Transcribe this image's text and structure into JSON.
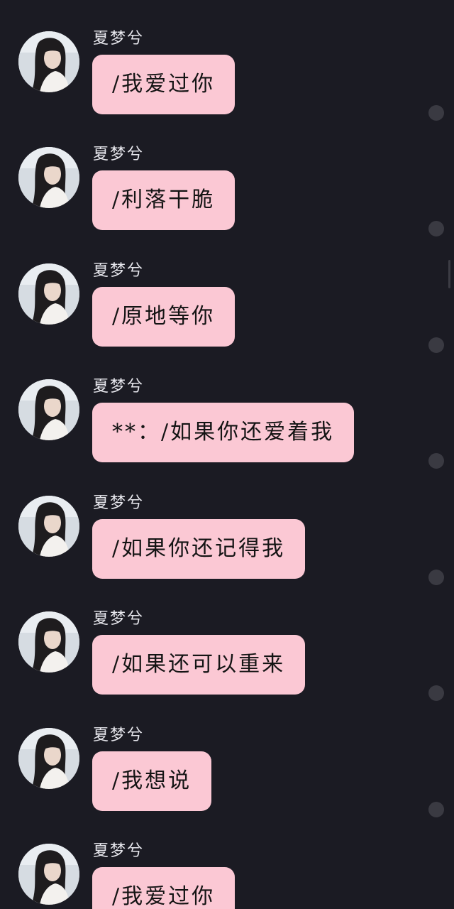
{
  "colors": {
    "background": "#1b1b23",
    "bubble": "#fbc8d4",
    "bubble_text": "#141414",
    "sender_text": "#e8e8ee",
    "select_circle": "#3a3a42"
  },
  "messages": [
    {
      "sender": "夏梦兮",
      "text": "/我爱过你",
      "avatar_icon": "user-avatar-icon"
    },
    {
      "sender": "夏梦兮",
      "text": "/利落干脆",
      "avatar_icon": "user-avatar-icon"
    },
    {
      "sender": "夏梦兮",
      "text": "/原地等你",
      "avatar_icon": "user-avatar-icon"
    },
    {
      "sender": "夏梦兮",
      "text": "**：/如果你还爱着我",
      "avatar_icon": "user-avatar-icon"
    },
    {
      "sender": "夏梦兮",
      "text": "/如果你还记得我",
      "avatar_icon": "user-avatar-icon"
    },
    {
      "sender": "夏梦兮",
      "text": "/如果还可以重来",
      "avatar_icon": "user-avatar-icon"
    },
    {
      "sender": "夏梦兮",
      "text": "/我想说",
      "avatar_icon": "user-avatar-icon"
    },
    {
      "sender": "夏梦兮",
      "text": "/我爱过你",
      "avatar_icon": "user-avatar-icon"
    }
  ]
}
